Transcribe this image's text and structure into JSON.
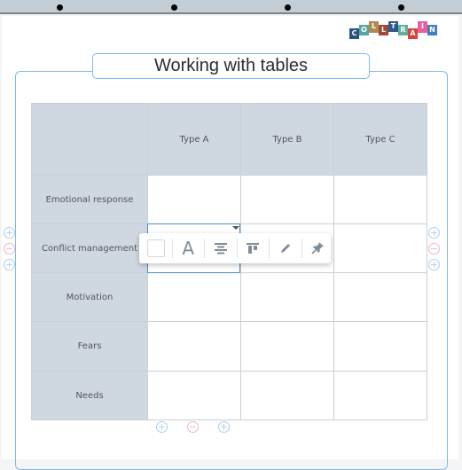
{
  "app": {
    "logo_letters": [
      "C",
      "O",
      "L",
      "L",
      "T",
      "R",
      "A",
      "I",
      "N"
    ],
    "logo_colors": [
      "#2c5282",
      "#57a7a0",
      "#b08a4e",
      "#a3473a",
      "#2c5a8a",
      "#5fb09c",
      "#d8433a",
      "#e9609f",
      "#3f7fc1"
    ],
    "logo_offsets": [
      1,
      0,
      -1,
      0,
      -1,
      0,
      1,
      -1,
      0
    ]
  },
  "header": {
    "title": "Working with tables"
  },
  "table": {
    "columns": [
      "",
      "Type A",
      "Type B",
      "Type C"
    ],
    "rows": [
      {
        "label": "Emotional response",
        "cells": [
          "",
          "",
          ""
        ]
      },
      {
        "label": "Conflict management",
        "cells": [
          "",
          "",
          ""
        ]
      },
      {
        "label": "Motivation",
        "cells": [
          "",
          "",
          ""
        ]
      },
      {
        "label": "Fears",
        "cells": [
          "",
          "",
          ""
        ]
      },
      {
        "label": "Needs",
        "cells": [
          "",
          "",
          ""
        ]
      }
    ],
    "selected": {
      "row": "Conflict management",
      "column": "Type A"
    }
  },
  "controls": {
    "plus_symbol": "+",
    "minus_symbol": "−",
    "left": [
      "add-row-above",
      "delete-row",
      "add-row-below"
    ],
    "right": [
      "add-row-above",
      "delete-row",
      "add-row-below"
    ],
    "bottom": [
      "add-column-left",
      "delete-column",
      "add-column-right"
    ]
  },
  "toolbar": {
    "items": [
      "background-color",
      "text-color",
      "text-align",
      "vertical-align",
      "edit",
      "pin"
    ],
    "text_color_glyph": "A"
  },
  "colors": {
    "accent": "#7bbaf0",
    "header_fill": "#cfd8e0",
    "add": "#a9cff2",
    "remove": "#f3b4bf"
  }
}
